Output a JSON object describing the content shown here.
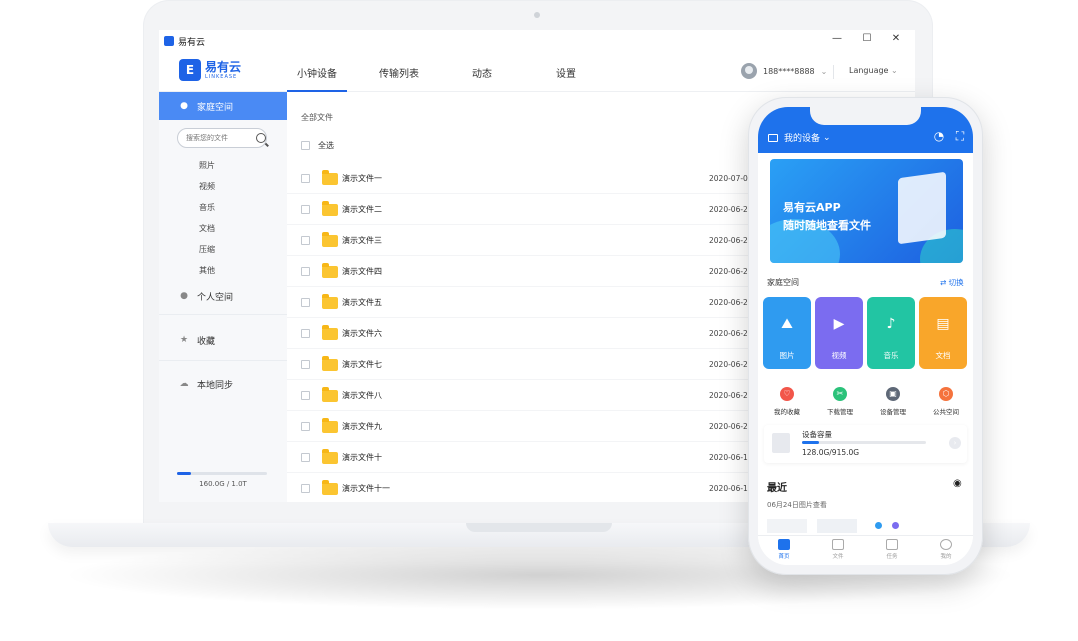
{
  "window": {
    "title": "易有云",
    "controls": {
      "min": "—",
      "max": "☐",
      "close": "✕"
    }
  },
  "brand": {
    "mark": "E",
    "name_cn": "易有云",
    "name_en": "LINKEASE",
    "color": "#1e63e6"
  },
  "nav": {
    "tabs": [
      "小钟设备",
      "传输列表",
      "动态",
      "设置"
    ],
    "active_index": 0
  },
  "user": {
    "phone": "188****8888",
    "language": "Language"
  },
  "sidebar": {
    "home": "家庭空间",
    "search_placeholder": "搜索您的文件",
    "sub_items": [
      "照片",
      "视频",
      "音乐",
      "文档",
      "压缩",
      "其他"
    ],
    "personal": "个人空间",
    "favorites": "收藏",
    "local_sync": "本地同步",
    "storage_text": "160.0G / 1.0T",
    "storage_fraction": 0.16
  },
  "main": {
    "breadcrumb": "全部文件",
    "select_all": "全选",
    "files": [
      {
        "name": "演示文件一",
        "date": "2020-07-02"
      },
      {
        "name": "演示文件二",
        "date": "2020-06-28"
      },
      {
        "name": "演示文件三",
        "date": "2020-06-28"
      },
      {
        "name": "演示文件四",
        "date": "2020-06-28"
      },
      {
        "name": "演示文件五",
        "date": "2020-06-28"
      },
      {
        "name": "演示文件六",
        "date": "2020-06-28"
      },
      {
        "name": "演示文件七",
        "date": "2020-06-24"
      },
      {
        "name": "演示文件八",
        "date": "2020-06-24"
      },
      {
        "name": "演示文件九",
        "date": "2020-06-24"
      },
      {
        "name": "演示文件十",
        "date": "2020-06-17"
      },
      {
        "name": "演示文件十一",
        "date": "2020-06-17"
      }
    ]
  },
  "phone": {
    "device": "我的设备",
    "banner": {
      "line1": "易有云APP",
      "line2": "随时随地查看文件"
    },
    "section_title": "家庭空间",
    "switch": "⇄ 切换",
    "tiles": [
      {
        "label": "图片",
        "color": "#2f9bf0"
      },
      {
        "label": "视频",
        "color": "#7b6cf0"
      },
      {
        "label": "音乐",
        "color": "#22c5a3"
      },
      {
        "label": "文档",
        "color": "#f9a62a"
      }
    ],
    "shortcuts": [
      {
        "label": "我的收藏",
        "color": "#f2564a"
      },
      {
        "label": "下载管理",
        "color": "#2bc27a"
      },
      {
        "label": "设备管理",
        "color": "#5e6877"
      },
      {
        "label": "公共空间",
        "color": "#f5733d"
      }
    ],
    "capacity": {
      "label": "设备容量",
      "value": "128.0G/915.0G",
      "fraction": 0.14
    },
    "recent": {
      "title": "最近",
      "subtitle": "06月24日图片查看"
    },
    "tabbar": [
      "首页",
      "文件",
      "任务",
      "我的"
    ]
  }
}
